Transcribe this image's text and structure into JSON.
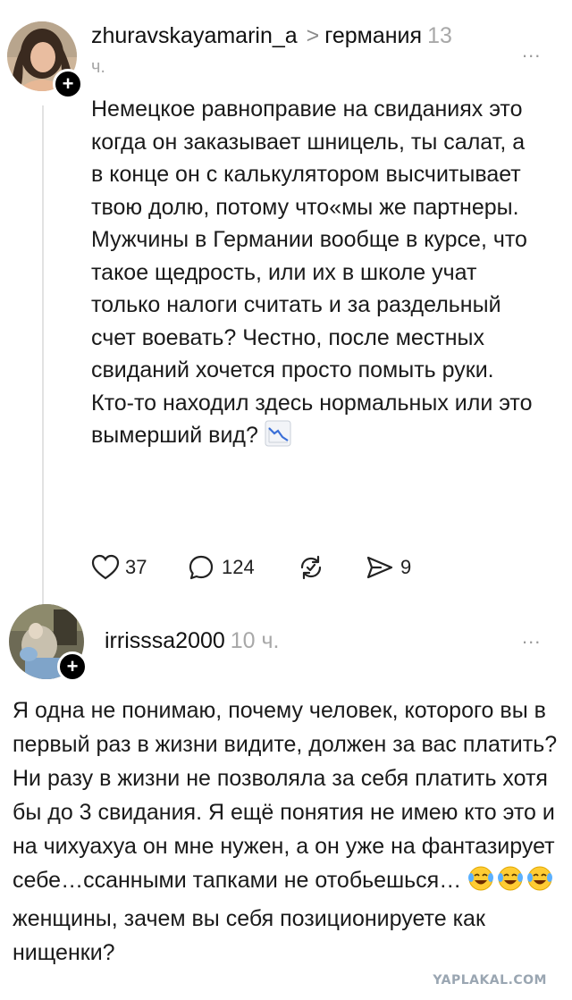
{
  "post1": {
    "username": "zhuravskayamarin_a",
    "topic": "германия",
    "time_num": "13",
    "time_unit": "ч.",
    "paragraph1": "Немецкое равноправие на свиданиях это когда он заказывает шницель, ты салат, а в конце он с калькулятором высчитывает твою долю, потому что«мы же партнеры.",
    "paragraph2": "Мужчины в Германии вообще в курсе, что такое щедрость, или их в школе учат только налоги считать и за раздельный счет воевать? Честно, после местных свиданий хочется просто помыть руки. Кто-то находил здесь нормальных или это вымерший вид?",
    "likes": "37",
    "comments": "124",
    "shares": "9",
    "more": "..."
  },
  "post2": {
    "username": "irrisssa2000",
    "time": "10 ч.",
    "text_before_emoji": "Я одна не понимаю, почему человек, которого вы в первый раз в жизни видите, должен за вас платить? Ни разу в жизни не позволяла за себя платить хотя бы до 3 свидания. Я ещё понятия не имею кто это и на чихуахуа он мне нужен, а он уже на фантазирует себе…ссанными тапками не отобьешься…",
    "text_after_emoji": "женщины, зачем вы себя позиционируете как нищенки?",
    "more": "..."
  },
  "icons": {
    "like": "heart-icon",
    "comment": "speech-bubble-icon",
    "repost": "repost-icon",
    "share": "send-icon",
    "follow": "plus-icon",
    "trend": "chart-decreasing-icon",
    "laugh": "tears-of-joy-icon"
  },
  "watermark": "YAPLAKAL.COM"
}
